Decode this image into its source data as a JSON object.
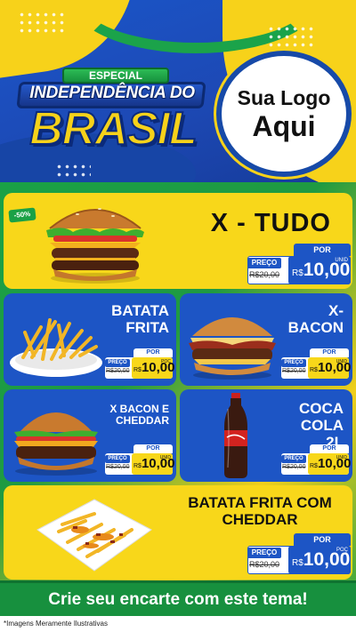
{
  "header": {
    "badge": "ESPECIAL",
    "title_line1": "INDEPENDÊNCIA DO",
    "title_line2": "BRASIL",
    "logo_line1": "Sua Logo",
    "logo_line2": "Aqui"
  },
  "colors": {
    "brand_blue": "#1d55c5",
    "brand_yellow": "#f8d71a",
    "brand_green": "#1aa146"
  },
  "products": [
    {
      "name": "X - TUDO",
      "discount": "-50%",
      "old_price": "R$20,00",
      "currency": "R$",
      "price": "10,00",
      "unit": "UNID",
      "por": "POR",
      "preco": "PREÇO",
      "icon": "burger-image"
    },
    {
      "name": "BATATA FRITA",
      "old_price": "R$20,00",
      "currency": "R$",
      "price": "10,00",
      "unit": "POÇ",
      "por": "POR",
      "preco": "PREÇO",
      "icon": "fries-image"
    },
    {
      "name": "X- BACON",
      "old_price": "R$20,00",
      "currency": "R$",
      "price": "10,00",
      "unit": "UNID",
      "por": "POR",
      "preco": "PREÇO",
      "icon": "bacon-burger-image"
    },
    {
      "name": "X BACON E CHEDDAR",
      "old_price": "R$20,00",
      "currency": "R$",
      "price": "10,00",
      "unit": "UNID",
      "por": "POR",
      "preco": "PREÇO",
      "icon": "cheddar-burger-image"
    },
    {
      "name": "COCA COLA 2L",
      "old_price": "R$20,00",
      "currency": "R$",
      "price": "10,00",
      "unit": "UNID",
      "por": "POR",
      "preco": "PREÇO",
      "icon": "soda-bottle-image"
    },
    {
      "name": "BATATA FRITA COM CHEDDAR",
      "old_price": "R$20,00",
      "currency": "R$",
      "price": "10,00",
      "unit": "POÇ",
      "por": "POR",
      "preco": "PREÇO",
      "icon": "cheddar-fries-image"
    }
  ],
  "footer": {
    "cta": "Crie seu encarte com este tema!",
    "disclaimer": "*Imagens Meramente Ilustrativas"
  }
}
